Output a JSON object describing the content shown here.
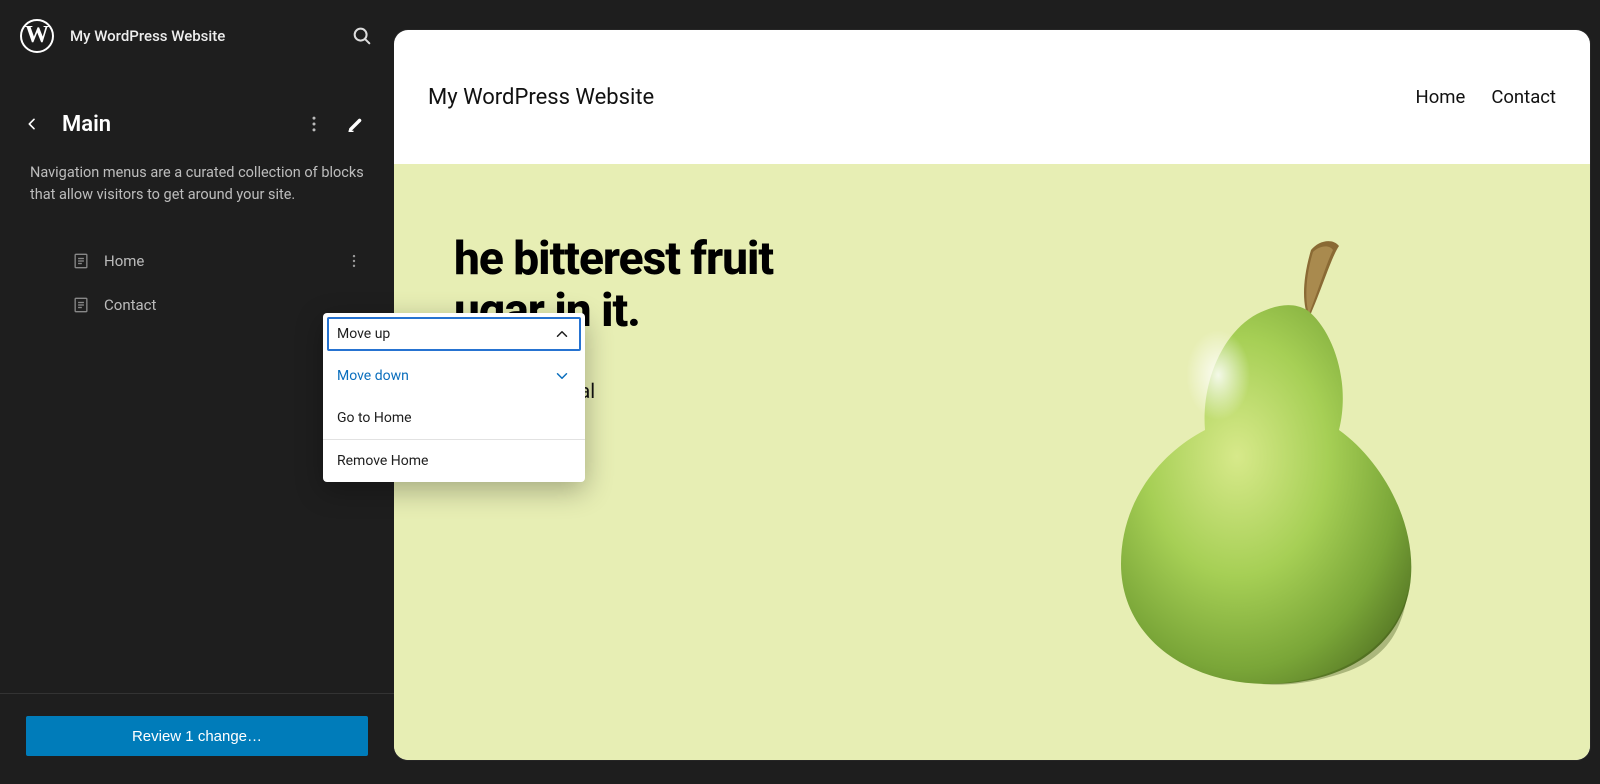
{
  "sidebar": {
    "site_title": "My WordPress Website",
    "page_title": "Main",
    "description": "Navigation menus are a curated collection of blocks that allow visitors to get around your site.",
    "nav_items": [
      {
        "label": "Home"
      },
      {
        "label": "Contact"
      }
    ],
    "review_button": "Review 1 change…"
  },
  "dropdown": {
    "move_up": "Move up",
    "move_down": "Move down",
    "go_to": "Go to Home",
    "remove": "Remove Home"
  },
  "preview": {
    "site_name": "My WordPress Website",
    "nav": [
      {
        "label": "Home"
      },
      {
        "label": "Contact"
      }
    ],
    "quote_line1": "he bitterest fruit",
    "quote_line2": "ugar in it.",
    "quote_cite": "– Terry a O'Neal"
  }
}
